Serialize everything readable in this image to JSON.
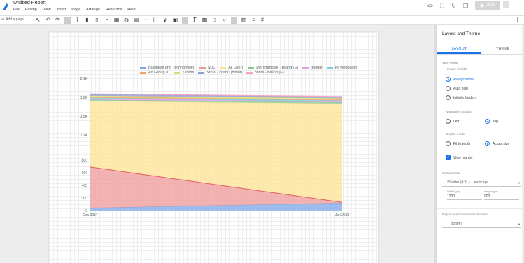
{
  "header": {
    "title": "Untitled Report",
    "menu": [
      "File",
      "Editing",
      "View",
      "Insert",
      "Page",
      "Arrange",
      "Resource",
      "Help"
    ],
    "view_label": "VIEW"
  },
  "toolbar": {
    "add_page_label": "Add a page"
  },
  "chart_data": {
    "type": "area",
    "stacked": true,
    "x": [
      "Dec 2017",
      "Jan 2018"
    ],
    "ylim": [
      0,
      2100
    ],
    "y_ticks": [
      "0",
      "200",
      "400",
      "600",
      "800",
      "1.2K",
      "1.5K",
      "1.8K",
      "2.1K"
    ],
    "y_tick_values": [
      0,
      200,
      400,
      600,
      800,
      1200,
      1500,
      1800,
      2100
    ],
    "series": [
      {
        "name": "Business and Technophiles",
        "color": "#7ea6e8",
        "values": [
          40,
          120
        ]
      },
      {
        "name": "SDC",
        "color": "#ef9a9a",
        "values": [
          650,
          10
        ]
      },
      {
        "name": "All Users",
        "color": "#fde293",
        "values": [
          1050,
          1570
        ]
      },
      {
        "name": "Merchandise - Brand (E)",
        "color": "#81c995",
        "values": [
          20,
          20
        ]
      },
      {
        "name": "google",
        "color": "#e69ee6",
        "values": [
          15,
          15
        ]
      },
      {
        "name": "All webpages",
        "color": "#80cbe0",
        "values": [
          15,
          15
        ]
      },
      {
        "name": "Ad Group #1",
        "color": "#f2a56b",
        "values": [
          15,
          15
        ]
      },
      {
        "name": "t shirts",
        "color": "#d5dc74",
        "values": [
          20,
          20
        ]
      },
      {
        "name": "Store - Brand (BMM)",
        "color": "#8c9ed8",
        "values": [
          20,
          20
        ]
      },
      {
        "name": "Store - Brand (E)",
        "color": "#f6a5c0",
        "values": [
          10,
          10
        ]
      }
    ],
    "legend_position": "top",
    "grid": true
  },
  "panel": {
    "title": "Layout and Theme",
    "tabs": [
      "LAYOUT",
      "THEME"
    ],
    "view_mode_label": "View Mode",
    "header_visibility_label": "Header visibility",
    "header_options": [
      "Always show",
      "Auto hide",
      "Initially hidden"
    ],
    "nav_position_label": "Navigation position",
    "nav_options": [
      "Left",
      "Top"
    ],
    "display_mode_label": "Display mode",
    "display_options": [
      "Fit to width",
      "Actual size"
    ],
    "view_margin_label": "View margin",
    "canvas_size_label": "Canvas Size",
    "canvas_size_value": "US letter (4:3) – Landscape",
    "width_label": "Width (px)",
    "width_value": "1200",
    "height_label": "Height (px)",
    "height_value": "900",
    "component_position_label": "Report-level Component Position",
    "component_position_value": "Bottom"
  }
}
